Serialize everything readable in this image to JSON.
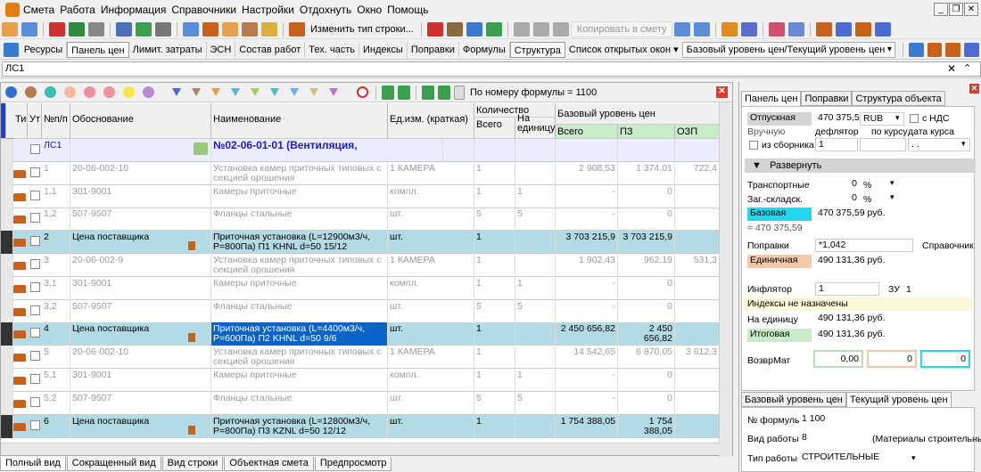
{
  "menu": [
    "Смета",
    "Работа",
    "Информация",
    "Справочники",
    "Настройки",
    "Отдохнуть",
    "Окно",
    "Помощь"
  ],
  "toolbar": {
    "change_row_type": "Изменить тип строки...",
    "copy_to_estimate": "Копировать в смету"
  },
  "tabs": [
    "Ресурсы",
    "Панель цен",
    "Лимит. затраты",
    "ЭСН",
    "Состав работ",
    "Тех. часть",
    "Индексы",
    "Поправки",
    "Формулы",
    "Структура"
  ],
  "open_windows": "Список открытых окон",
  "price_level_combo": "Базовый уровень цен/Текущий уровень цен",
  "address": "ЛС1",
  "filter": {
    "formula_text": "По номеру формулы = 1100",
    "dot_colors": [
      "#2f6fd0",
      "#b87c4c",
      "#3cbfb4",
      "#f5b9a0",
      "#f08fa0",
      "#f5e44a",
      "#f0a0d0",
      "#b98ad8"
    ],
    "funnel_colors": [
      "#4a6cd4",
      "#b08070",
      "#e8a040",
      "#5cb0e0",
      "#a0d060",
      "#50c0c0",
      "#70b0f0",
      "#d0c080",
      "#c070d0"
    ]
  },
  "columns": {
    "ti": "Ти",
    "ut": "Ут",
    "num": "№п/п",
    "basis": "Обоснование",
    "name": "Наименование",
    "unit": "Ед.изм. (краткая)",
    "qty": "Количество",
    "qty_total": "Всего",
    "qty_per_unit": "На единицу",
    "base_level": "Базовый уровень цен",
    "total": "Всего",
    "pz": "ПЗ",
    "ozp": "ОЗП"
  },
  "rows": [
    {
      "style": "sec",
      "num": "ЛС1",
      "basis": "",
      "name": "№02-06-01-01 (Вентиляция,",
      "unit": "",
      "qty": "",
      "per": "",
      "total": "",
      "pz": "",
      "ozp": ""
    },
    {
      "style": "grey",
      "num": "1",
      "basis": "20-06-002-10",
      "name": "Установка камер приточных типовых с секцией орошения производительностью",
      "unit": "1 КАМЕРА",
      "qty": "1",
      "per": "",
      "total": "2 908,53",
      "pz": "1 374,01",
      "ozp": "722,4"
    },
    {
      "style": "grey",
      "num": "1,1",
      "basis": "301-9001",
      "name": "Камеры приточные",
      "unit": "компл.",
      "qty": "1",
      "per": "1",
      "total": "-",
      "pz": "0",
      "ozp": ""
    },
    {
      "style": "grey",
      "num": "1,2",
      "basis": "507-9507",
      "name": "Фланцы стальные",
      "unit": "шт.",
      "qty": "5",
      "per": "5",
      "total": "-",
      "pz": "0",
      "ozp": ""
    },
    {
      "style": "teal",
      "num": "2",
      "basis": "Цена поставщика",
      "name": "Приточная установка (L=12900м3/ч, P=800Па) П1 KHNL d=50 15/12",
      "unit": "шт.",
      "qty": "1",
      "per": "",
      "total": "3 703 215,9",
      "pz": "3 703 215,9",
      "ozp": ""
    },
    {
      "style": "grey",
      "num": "3",
      "basis": "20-06-002-9",
      "name": "Установка камер приточных типовых с секцией орошения производительностью",
      "unit": "1 КАМЕРА",
      "qty": "1",
      "per": "",
      "total": "1 902,43",
      "pz": "962,19",
      "ozp": "531,3"
    },
    {
      "style": "grey",
      "num": "3,1",
      "basis": "301-9001",
      "name": "Камеры приточные",
      "unit": "компл.",
      "qty": "1",
      "per": "1",
      "total": "-",
      "pz": "0",
      "ozp": ""
    },
    {
      "style": "grey",
      "num": "3,2",
      "basis": "507-9507",
      "name": "Фланцы стальные",
      "unit": "шт.",
      "qty": "5",
      "per": "5",
      "total": "-",
      "pz": "0",
      "ozp": ""
    },
    {
      "style": "teal",
      "num": "4",
      "basis": "Цена поставщика",
      "name": "Приточная установка (L=4400м3/ч, P=600Па) П2 KHNL d=50 9/6",
      "unit": "шт.",
      "qty": "1",
      "per": "",
      "total": "2 450 656,82",
      "pz": "2 450 656,82",
      "ozp": ""
    },
    {
      "style": "grey",
      "num": "5",
      "basis": "20-06-002-10",
      "name": "Установка камер приточных типовых с секцией орошения производительностью",
      "unit": "1 КАМЕРА",
      "qty": "1",
      "per": "",
      "total": "14 542,65",
      "pz": "6 870,05",
      "ozp": "3 612,3"
    },
    {
      "style": "grey",
      "num": "5,1",
      "basis": "301-9001",
      "name": "Камеры приточные",
      "unit": "компл.",
      "qty": "1",
      "per": "1",
      "total": "-",
      "pz": "0",
      "ozp": ""
    },
    {
      "style": "grey",
      "num": "5,2",
      "basis": "507-9507",
      "name": "Фланцы стальные",
      "unit": "шт.",
      "qty": "5",
      "per": "5",
      "total": "-",
      "pz": "0",
      "ozp": ""
    },
    {
      "style": "teal",
      "num": "6",
      "basis": "Цена поставщика",
      "name": "Приточная установка (L=12800м3/ч, P=800Па) П3 KZNL d=50 12/12",
      "unit": "шт.",
      "qty": "1",
      "per": "",
      "total": "1 754 388,05",
      "pz": "1 754 388,05",
      "ozp": ""
    }
  ],
  "bottom_tabs": [
    "Полный вид",
    "Сокращенный вид",
    "Вид строки",
    "Объектная смета",
    "Предпросмотр"
  ],
  "right": {
    "tabs": [
      "Панель цен",
      "Поправки",
      "Структура объекта"
    ],
    "sale": "Отпускная",
    "sale_val": "470 375,5!",
    "currency": "RUB",
    "nds": "с НДС",
    "manual": "Вручную",
    "deflator": "дефлятор",
    "by_rate": "по курсу",
    "rate_date": "дата курса",
    "from_collection": "из сборника",
    "coef": "1",
    "date_val": ". .",
    "expand": "Развернуть",
    "transport": "Транспортные",
    "transport_val": "0",
    "pct": "%",
    "warehouse": "Заг.-складск.",
    "warehouse_val": "0",
    "base": "Базовая",
    "base_val": "470 375,59 руб.",
    "base_eq": "= 470 375,59",
    "corrections": "Поправки",
    "corr_val": "*1,042",
    "reference": "Справочник",
    "unit_price": "Единичная",
    "unit_val": "490 131,36 руб.",
    "inflator": "Инфлятор",
    "infl_val": "1",
    "zu": "ЗУ",
    "zu_val": "1",
    "indices_none": "Индексы не назначены",
    "per_unit": "На единицу",
    "per_unit_val": "490 131,36 руб.",
    "final": "Итоговая",
    "final_val": "490 131,36 руб.",
    "return_mat": "ВозврМат",
    "rm1": "0,00",
    "rm2": "0",
    "rm3": "0",
    "level_tabs": [
      "Базовый уровень цен",
      "Текущий уровень цен"
    ],
    "formula_no": "№ формулы",
    "formula_val": "1 100",
    "work_type": "Вид работы",
    "work_val": "8",
    "work_desc": "(Материалы строительные",
    "work_kind": "Тип работы",
    "work_kind_val": "СТРОИТЕЛЬНЫЕ"
  }
}
